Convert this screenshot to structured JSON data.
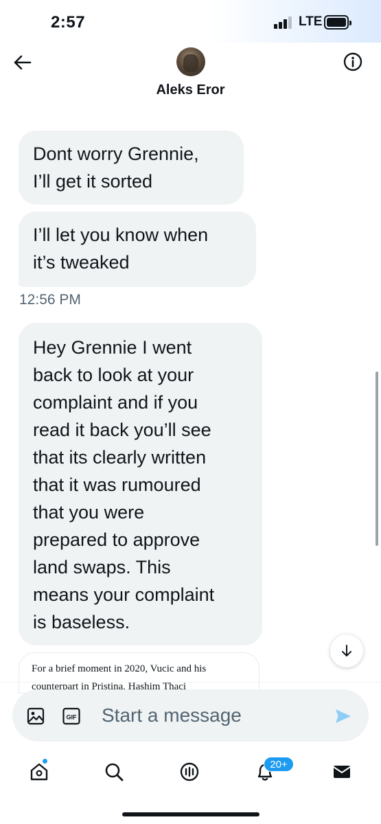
{
  "status_bar": {
    "time": "2:57",
    "network": "LTE",
    "signal_bars": 3,
    "battery_level": "full"
  },
  "header": {
    "contact_name": "Aleks Eror",
    "back_icon": "arrow-left-icon",
    "info_icon": "info-icon"
  },
  "messages": [
    {
      "text_lines": [
        "Dont worry Grennie,",
        "I’ll get it sorted"
      ]
    },
    {
      "text_lines": [
        "I’ll let you know when",
        "it’s tweaked"
      ]
    },
    {
      "text_lines": [
        "Hey Grennie I went",
        "back to look at your",
        "complaint and if you",
        "read it back you’ll see",
        "that its clearly written",
        "that it was rumoured",
        "that you were",
        "prepared to approve",
        "land swaps. This",
        "means your complaint",
        "is baseless."
      ]
    }
  ],
  "timestamp": "12:56 PM",
  "link_preview": {
    "line1": "For a brief moment in 2020, Vucic and his",
    "line2": "counterpart in Pristina, Hashim Thaci"
  },
  "composer": {
    "placeholder": "Start a message",
    "image_icon": "image-icon",
    "gif_label": "GIF",
    "send_icon": "send-icon"
  },
  "tabbar": {
    "items": [
      {
        "name": "home",
        "icon": "home-icon"
      },
      {
        "name": "search",
        "icon": "search-icon"
      },
      {
        "name": "spaces",
        "icon": "spaces-icon"
      },
      {
        "name": "notifications",
        "icon": "bell-icon"
      },
      {
        "name": "messages",
        "icon": "mail-icon"
      }
    ],
    "notifications_badge": "20+"
  },
  "colors": {
    "accent": "#1d9bf0",
    "bubble": "#eff3f4",
    "text": "#0f1419",
    "secondary_text": "#536471"
  }
}
